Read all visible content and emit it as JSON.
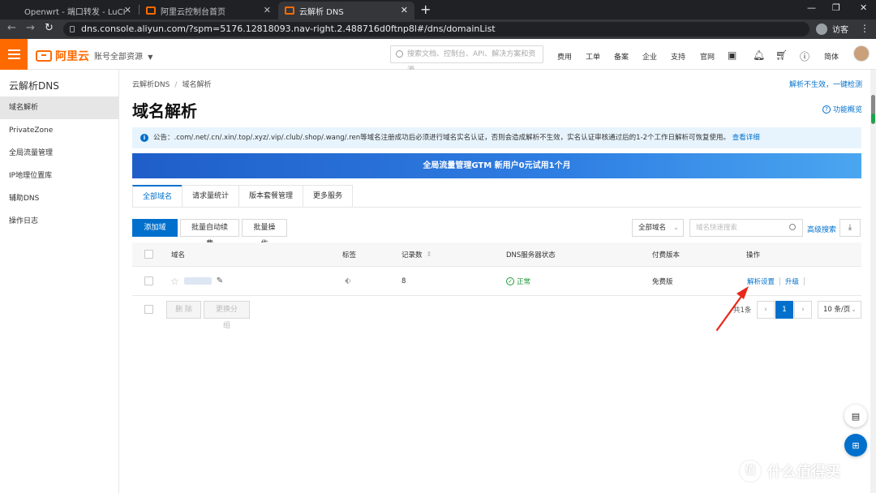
{
  "browser": {
    "tabs": [
      {
        "label": "Openwrt - 端口转发 - LuCI",
        "active": false
      },
      {
        "label": "阿里云控制台首页",
        "active": false
      },
      {
        "label": "云解析 DNS",
        "active": true
      }
    ],
    "url": "dns.console.aliyun.com/?spm=5176.12818093.nav-right.2.488716d0ftnp8l#/dns/domainList",
    "profile_label": "访客"
  },
  "topbar": {
    "logo_text": "阿里云",
    "account_label": "账号全部资源",
    "search_placeholder": "搜索文档、控制台、API、解决方案和资源",
    "nav": [
      "费用",
      "工单",
      "备案",
      "企业",
      "支持",
      "官网"
    ],
    "lang": "简体"
  },
  "sidebar": {
    "title": "云解析DNS",
    "items": [
      {
        "label": "域名解析",
        "active": true
      },
      {
        "label": "PrivateZone",
        "active": false
      },
      {
        "label": "全局流量管理",
        "active": false
      },
      {
        "label": "IP地理位置库",
        "active": false
      },
      {
        "label": "辅助DNS",
        "active": false
      },
      {
        "label": "操作日志",
        "active": false
      }
    ]
  },
  "main": {
    "breadcrumb": [
      "云解析DNS",
      "域名解析"
    ],
    "recheck_link": "解析不生效，一键检测",
    "title": "域名解析",
    "overview_link": "功能概览",
    "notice_text": "公告：.com/.net/.cn/.xin/.top/.xyz/.vip/.club/.shop/.wang/.ren等域名注册成功后必须进行域名实名认证，否则会造成解析不生效，实名认证审核通过后的1-2个工作日解析可恢复使用。",
    "notice_link": "查看详细",
    "banner_text": "全局流量管理GTM 新用户0元试用1个月",
    "tabs": [
      "全部域名",
      "请求量统计",
      "版本套餐管理",
      "更多服务"
    ],
    "toolbar": {
      "add_domain": "添加域名",
      "batch_renew": "批量自动续费",
      "batch_ops": "批量操作",
      "filter_select": "全部域名",
      "search_placeholder": "域名快速搜索",
      "advanced_search": "高级搜索"
    },
    "table": {
      "headers": [
        "域名",
        "标签",
        "记录数",
        "DNS服务器状态",
        "付费版本",
        "操作"
      ],
      "rows": [
        {
          "domain": "",
          "records": "8",
          "dns_status": "正常",
          "edition": "免费版",
          "action_settings": "解析设置",
          "action_upgrade": "升级"
        }
      ]
    },
    "footer": {
      "delete_label": "删 除",
      "change_group_label": "更换分组",
      "total_text": "共1条",
      "current_page": "1",
      "page_size": "10 条/页"
    }
  },
  "colors": {
    "brand_orange": "#ff6a00",
    "link_blue": "#0070cc",
    "ok_green": "#1f9a3a",
    "annotation_red": "#e8281b"
  },
  "watermark": {
    "badge": "值",
    "text": "什么值得买"
  }
}
